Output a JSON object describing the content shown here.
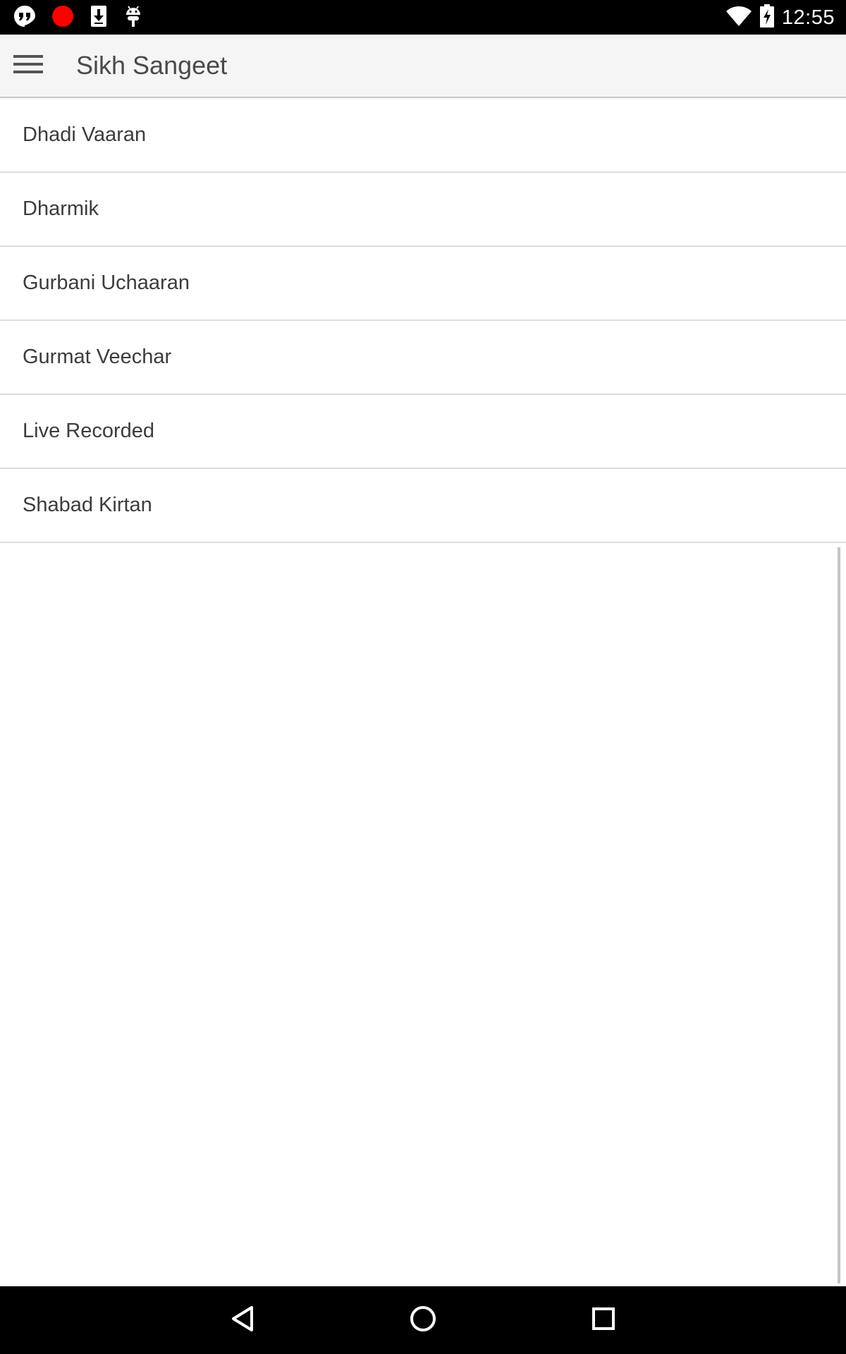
{
  "status_bar": {
    "time": "12:55",
    "left_icons": [
      "hangouts-icon",
      "record-icon",
      "download-icon",
      "android-debug-icon"
    ],
    "right_icons": [
      "wifi-icon",
      "battery-charging-icon"
    ],
    "record_color": "#ff0000"
  },
  "app_bar": {
    "menu_icon": "hamburger-menu-icon",
    "title": "Sikh Sangeet"
  },
  "categories": [
    {
      "label": "Dhadi Vaaran"
    },
    {
      "label": "Dharmik"
    },
    {
      "label": "Gurbani Uchaaran"
    },
    {
      "label": "Gurmat Veechar"
    },
    {
      "label": "Live Recorded"
    },
    {
      "label": "Shabad Kirtan"
    }
  ],
  "nav_bar": {
    "buttons": [
      "back-icon",
      "home-icon",
      "recents-icon"
    ]
  },
  "colors": {
    "app_bar_bg": "#f5f5f5",
    "text": "#3c3c3c",
    "divider": "#dcdcdc",
    "system_bars": "#000000"
  }
}
